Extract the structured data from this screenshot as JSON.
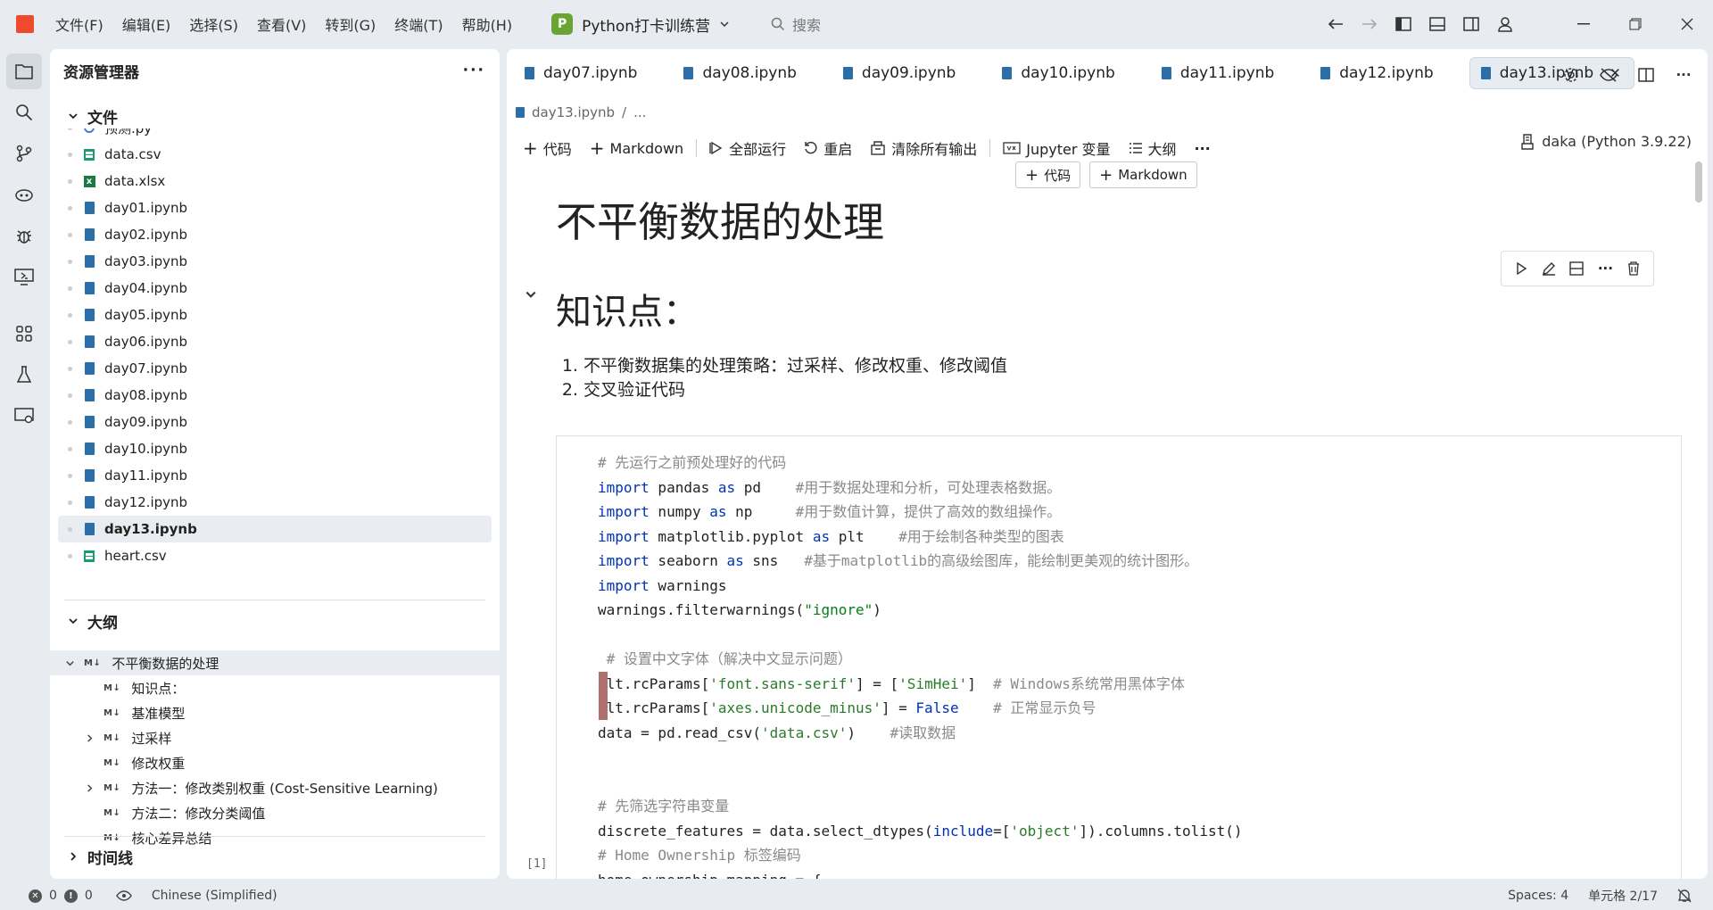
{
  "titlebar": {
    "menu": [
      "文件(F)",
      "编辑(E)",
      "选择(S)",
      "查看(V)",
      "转到(G)",
      "终端(T)",
      "帮助(H)"
    ],
    "project_badge": "P",
    "project_name": "Python打卡训练营",
    "search_placeholder": "搜索"
  },
  "sidebar": {
    "title": "资源管理器",
    "files_section": "文件",
    "files": [
      {
        "name": "预测.py",
        "type": "py"
      },
      {
        "name": "data.csv",
        "type": "csv"
      },
      {
        "name": "data.xlsx",
        "type": "xlsx"
      },
      {
        "name": "day01.ipynb",
        "type": "nb"
      },
      {
        "name": "day02.ipynb",
        "type": "nb"
      },
      {
        "name": "day03.ipynb",
        "type": "nb"
      },
      {
        "name": "day04.ipynb",
        "type": "nb"
      },
      {
        "name": "day05.ipynb",
        "type": "nb"
      },
      {
        "name": "day06.ipynb",
        "type": "nb"
      },
      {
        "name": "day07.ipynb",
        "type": "nb"
      },
      {
        "name": "day08.ipynb",
        "type": "nb"
      },
      {
        "name": "day09.ipynb",
        "type": "nb"
      },
      {
        "name": "day10.ipynb",
        "type": "nb"
      },
      {
        "name": "day11.ipynb",
        "type": "nb"
      },
      {
        "name": "day12.ipynb",
        "type": "nb"
      },
      {
        "name": "day13.ipynb",
        "type": "nb"
      },
      {
        "name": "heart.csv",
        "type": "csv"
      }
    ],
    "outline_section": "大纲",
    "outline_badge": "M↓",
    "outline": [
      {
        "label": "不平衡数据的处理",
        "level": 0,
        "chev": "v"
      },
      {
        "label": "知识点：",
        "level": 1,
        "chev": ""
      },
      {
        "label": "基准模型",
        "level": 1,
        "chev": ""
      },
      {
        "label": "过采样",
        "level": 1,
        "chev": ">"
      },
      {
        "label": "修改权重",
        "level": 1,
        "chev": ""
      },
      {
        "label": "方法一：修改类别权重 (Cost-Sensitive Learning)",
        "level": 1,
        "chev": ">"
      },
      {
        "label": "方法二：修改分类阈值",
        "level": 1,
        "chev": ""
      },
      {
        "label": "核心差异总结",
        "level": 1,
        "chev": ""
      }
    ],
    "timeline_section": "时间线"
  },
  "editor": {
    "tabs": [
      "day07.ipynb",
      "day08.ipynb",
      "day09.ipynb",
      "day10.ipynb",
      "day11.ipynb",
      "day12.ipynb",
      "day13.ipynb"
    ],
    "breadcrumb": "day13.ipynb",
    "breadcrumb_more": "...",
    "toolbar": {
      "code": "代码",
      "markdown": "Markdown",
      "run_all": "全部运行",
      "restart": "重启",
      "clear": "清除所有输出",
      "variables": "Jupyter 变量",
      "outline": "大纲",
      "more": "···"
    },
    "kernel": "daka (Python 3.9.22)",
    "insert_code": "代码",
    "insert_markdown": "Markdown",
    "h1": "不平衡数据的处理",
    "h2": "知识点：",
    "list": [
      "不平衡数据集的处理策略：过采样、修改权重、修改阈值",
      "交叉验证代码"
    ],
    "exec_count": "[1]"
  },
  "statusbar": {
    "errors": "0",
    "warnings": "0",
    "language": "Chinese (Simplified)",
    "spaces": "Spaces: 4",
    "cell": "单元格 2/17"
  },
  "colors": {
    "accent": "#2b6ea8",
    "logo": "#f04a2c",
    "project_badge": "#6aa533"
  }
}
